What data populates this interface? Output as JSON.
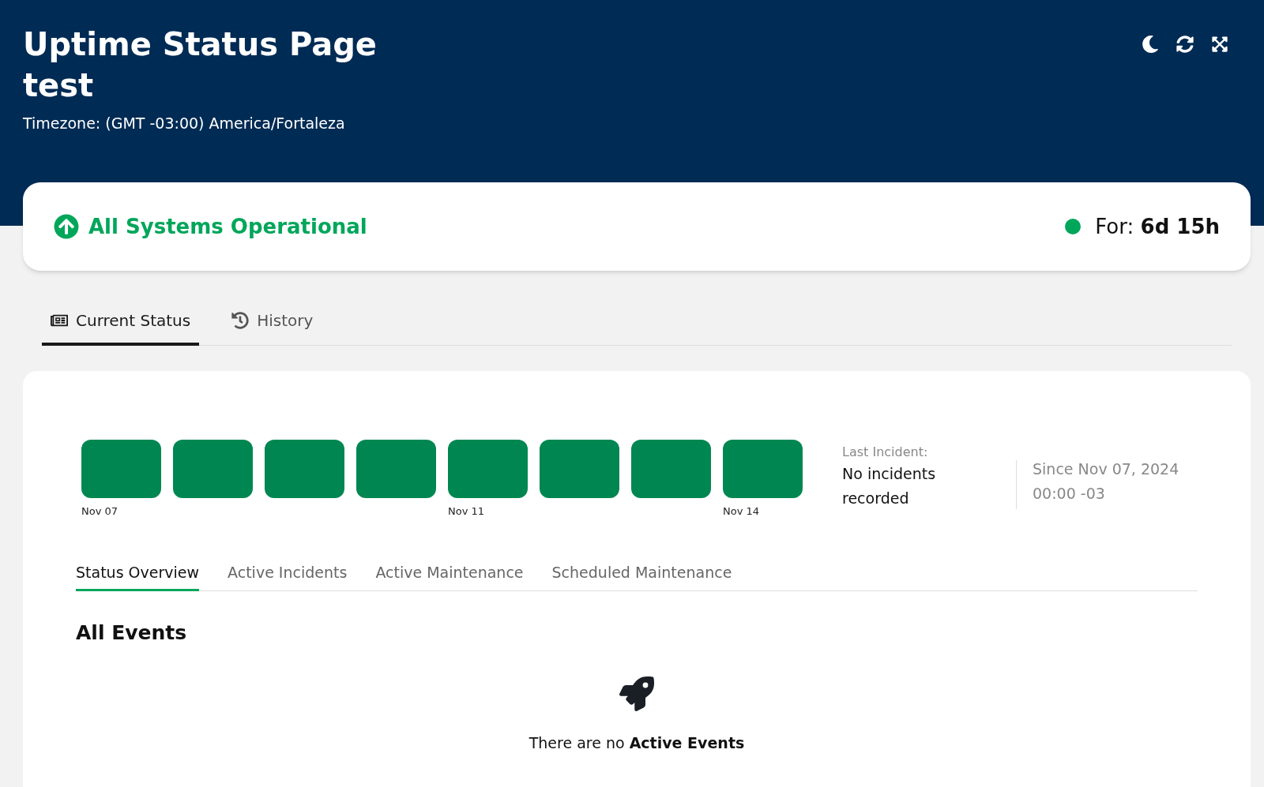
{
  "header": {
    "title": "Uptime Status Page test",
    "timezone": "Timezone: (GMT -03:00) America/Fortaleza"
  },
  "status": {
    "text": "All Systems Operational",
    "for_label": "For:",
    "duration": "6d 15h"
  },
  "tabs": [
    {
      "label": "Current Status",
      "selected": true,
      "kind": "current"
    },
    {
      "label": "History",
      "selected": false,
      "kind": "history"
    }
  ],
  "uptime_bars": [
    {
      "operational": true,
      "label": "Nov 07"
    },
    {
      "operational": true
    },
    {
      "operational": true
    },
    {
      "operational": true
    },
    {
      "operational": true,
      "label": "Nov 11"
    },
    {
      "operational": true
    },
    {
      "operational": true
    },
    {
      "operational": true,
      "label": "Nov 14"
    }
  ],
  "last_incident": {
    "label": "Last Incident:",
    "value": "No incidents recorded",
    "since": "Since Nov 07, 2024 00:00 -03"
  },
  "sub_tabs": [
    {
      "label": "Status Overview",
      "selected": true
    },
    {
      "label": "Active Incidents",
      "selected": false
    },
    {
      "label": "Active Maintenance",
      "selected": false
    },
    {
      "label": "Scheduled Maintenance",
      "selected": false
    }
  ],
  "events": {
    "heading": "All Events",
    "empty_message": "There are no **Active Events**"
  }
}
